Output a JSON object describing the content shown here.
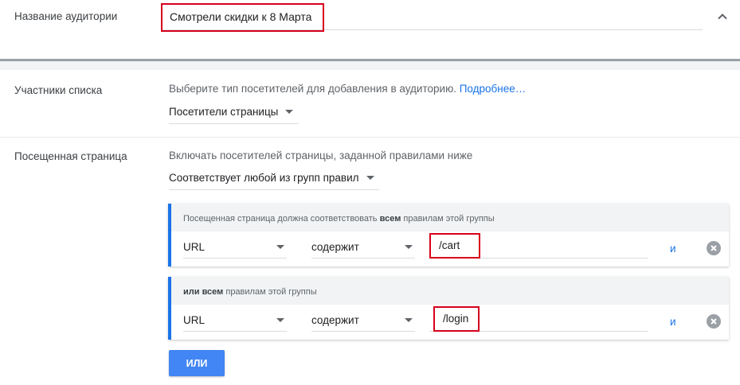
{
  "audience_name": {
    "label": "Название аудитории",
    "value": "Смотрели скидки к 8 Марта"
  },
  "members": {
    "label": "Участники списка",
    "hint": "Выберите тип посетителей для добавления в аудиторию.",
    "more_link": "Подробнее…",
    "selected": "Посетители страницы"
  },
  "visited_page": {
    "label": "Посещенная страница",
    "hint": "Включать посетителей страницы, заданной правилами ниже",
    "selected": "Соответствует любой из групп правил"
  },
  "rule_groups": [
    {
      "header_prefix": "Посещенная страница должна соответствовать",
      "header_bold": "всем",
      "header_suffix": "правилам этой группы",
      "field": "URL",
      "operator": "содержит",
      "value": "/cart",
      "and_label": "и"
    },
    {
      "header_prefix": "",
      "header_bold": "или всем",
      "header_suffix": "правилам этой группы",
      "field": "URL",
      "operator": "содержит",
      "value": "/login",
      "and_label": "и"
    }
  ],
  "or_button": "ИЛИ",
  "colors": {
    "accent": "#1a73e8",
    "highlight_border": "#d6001c",
    "button": "#4285f4"
  }
}
